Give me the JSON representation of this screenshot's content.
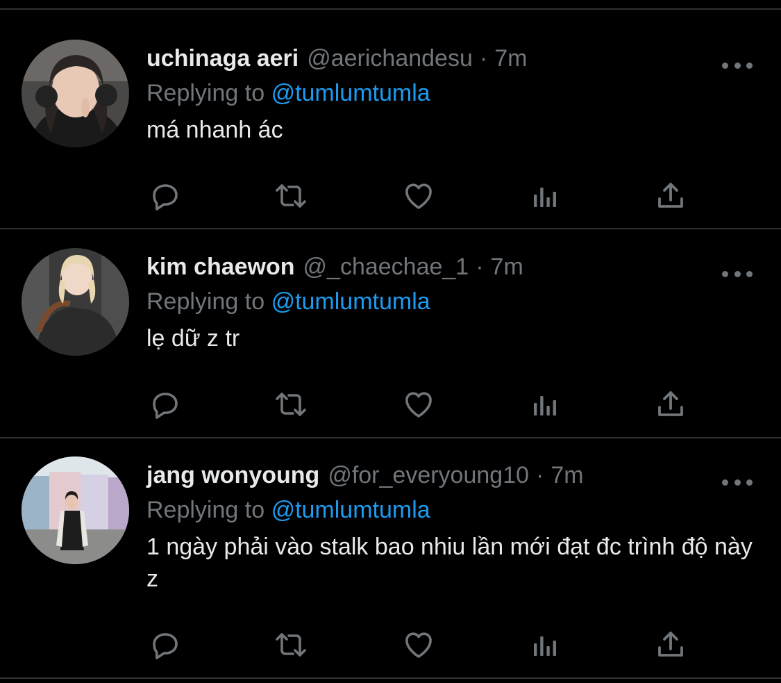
{
  "colors": {
    "background": "#000000",
    "text_primary": "#e7e9ea",
    "text_secondary": "#71767b",
    "accent": "#1d9bf0",
    "divider": "#2f3336"
  },
  "tweets": [
    {
      "display_name": "uchinaga aeri",
      "handle": "@aerichandesu",
      "separator": "·",
      "time": "7m",
      "replying_prefix": "Replying to",
      "replying_to": "@tumlumtumla",
      "text": "má nhanh ác",
      "avatar_icon": "avatar-photo"
    },
    {
      "display_name": "kim chaewon",
      "handle": "@_chaechae_1",
      "separator": "·",
      "time": "7m",
      "replying_prefix": "Replying to",
      "replying_to": "@tumlumtumla",
      "text": "lẹ dữ z tr",
      "avatar_icon": "avatar-photo"
    },
    {
      "display_name": "jang wonyoung",
      "handle": "@for_everyoung10",
      "separator": "·",
      "time": "7m",
      "replying_prefix": "Replying to",
      "replying_to": "@tumlumtumla",
      "text": "1 ngày phải vào stalk bao nhiu lần mới đạt đc trình độ này z",
      "avatar_icon": "avatar-photo"
    }
  ],
  "action_icons": [
    "reply-icon",
    "retweet-icon",
    "like-icon",
    "analytics-icon",
    "share-icon"
  ]
}
